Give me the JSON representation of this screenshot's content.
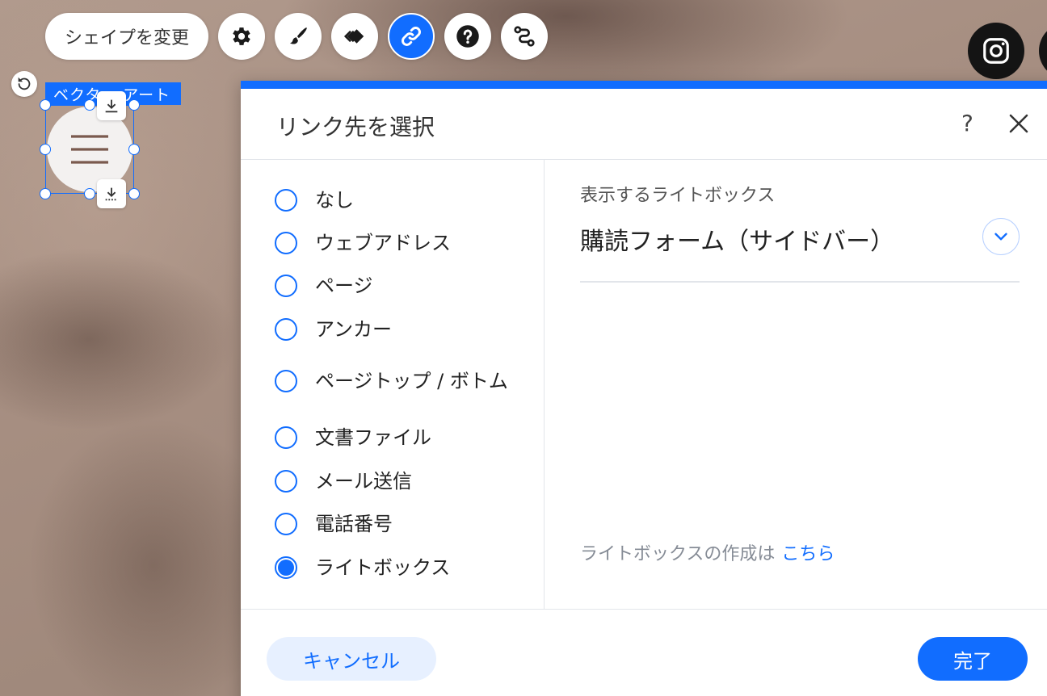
{
  "toolbar": {
    "change_shape_label": "シェイプを変更",
    "icons": [
      "gear-icon",
      "brush-icon",
      "animation-icon",
      "link-icon",
      "help-icon",
      "path-icon"
    ],
    "active_icon": "link-icon"
  },
  "element": {
    "label": "ベクター アート",
    "icon": "hamburger-menu-icon"
  },
  "social": [
    "instagram-icon"
  ],
  "dialog": {
    "title": "リンク先を選択",
    "help_label": "?",
    "options": [
      {
        "label": "なし",
        "checked": false
      },
      {
        "label": "ウェブアドレス",
        "checked": false
      },
      {
        "label": "ページ",
        "checked": false
      },
      {
        "label": "アンカー",
        "checked": false
      },
      {
        "label": "ページトップ / ボトム",
        "checked": false
      },
      {
        "label": "文書ファイル",
        "checked": false
      },
      {
        "label": "メール送信",
        "checked": false
      },
      {
        "label": "電話番号",
        "checked": false
      },
      {
        "label": "ライトボックス",
        "checked": true
      }
    ],
    "lightbox": {
      "caption": "表示するライトボックス",
      "selected": "購読フォーム（サイドバー）",
      "create_text": "ライトボックスの作成は",
      "create_link": "こちら"
    },
    "cancel_label": "キャンセル",
    "done_label": "完了"
  },
  "colors": {
    "accent": "#116dff",
    "accent_light": "#e7f0ff",
    "hamburger": "#7a5a4e"
  }
}
